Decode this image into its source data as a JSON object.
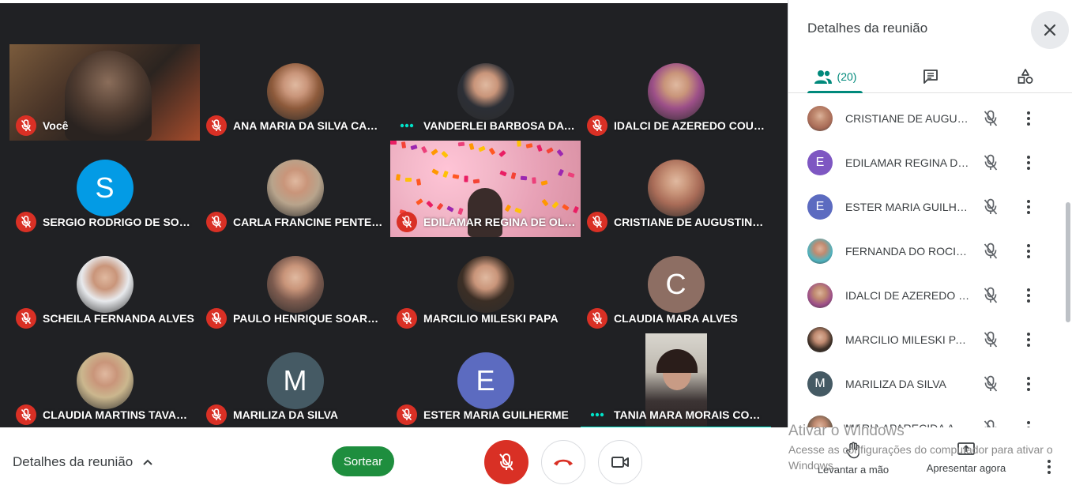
{
  "grid": {
    "tiles": [
      {
        "name": "Você",
        "mic": "off",
        "kind": "video-self"
      },
      {
        "name": "ANA MARIA DA SILVA CAMP...",
        "mic": "off",
        "kind": "photo",
        "color": "#8d5a3b"
      },
      {
        "name": "VANDERLEI BARBOSA DA SI...",
        "mic": "speaking",
        "kind": "photo",
        "color": "#2c2f36"
      },
      {
        "name": "IDALCI DE AZEREDO COUTIN...",
        "mic": "off",
        "kind": "photo",
        "color": "#9c4f88"
      },
      {
        "name": "SERGIO RODRIGO DE SOUZA...",
        "mic": "off",
        "kind": "letter",
        "letter": "S",
        "color": "#039be5"
      },
      {
        "name": "CARLA FRANCINE PENTEADO",
        "mic": "off",
        "kind": "photo",
        "color": "#b8a48c"
      },
      {
        "name": "EDILAMAR REGINA DE OLIV...",
        "mic": "off",
        "kind": "video-confetti"
      },
      {
        "name": "CRISTIANE DE AUGUSTINHO...",
        "mic": "off",
        "kind": "photo",
        "color": "#a86b57"
      },
      {
        "name": "SCHEILA FERNANDA ALVES",
        "mic": "off",
        "kind": "photo",
        "color": "#e8eaed"
      },
      {
        "name": "PAULO HENRIQUE SOARES B...",
        "mic": "off",
        "kind": "photo",
        "color": "#7b5a4e"
      },
      {
        "name": "MARCILIO MILESKI PAPA",
        "mic": "off",
        "kind": "photo",
        "color": "#3b2e25"
      },
      {
        "name": "CLAUDIA MARA ALVES",
        "mic": "off",
        "kind": "letter",
        "letter": "C",
        "color": "#8d6e63"
      },
      {
        "name": "CLAUDIA MARTINS TAVARES",
        "mic": "off",
        "kind": "photo",
        "color": "#cbb78e"
      },
      {
        "name": "MARILIZA DA SILVA",
        "mic": "off",
        "kind": "letter",
        "letter": "M",
        "color": "#455a64"
      },
      {
        "name": "ESTER MARIA GUILHERME",
        "mic": "off",
        "kind": "letter",
        "letter": "E",
        "color": "#5c6bc0"
      },
      {
        "name": "TANIA MARA MORAIS CORD...",
        "mic": "speaking",
        "kind": "video-tania"
      }
    ]
  },
  "side": {
    "title": "Detalhes da reunião",
    "tabs": {
      "people_count": "(20)"
    },
    "participants": [
      {
        "name": "CRISTIANE DE AUGUSTI...",
        "avatar": "photo",
        "color": "#a86b57"
      },
      {
        "name": "EDILAMAR REGINA DE ...",
        "avatar": "letter",
        "letter": "E",
        "color": "#7e57c2"
      },
      {
        "name": "ESTER MARIA GUILHER...",
        "avatar": "letter",
        "letter": "E",
        "color": "#5c6bc0"
      },
      {
        "name": "FERNANDA DO ROCIO ...",
        "avatar": "photo",
        "color": "#4fb3bf"
      },
      {
        "name": "IDALCI DE AZEREDO C...",
        "avatar": "photo",
        "color": "#9c4f88"
      },
      {
        "name": "MARCILIO MILESKI PAPA",
        "avatar": "photo",
        "color": "#3b2e25"
      },
      {
        "name": "MARILIZA DA SILVA",
        "avatar": "letter",
        "letter": "M",
        "color": "#455a64"
      },
      {
        "name": "MARIA APARECIDA ALB...",
        "avatar": "photo",
        "color": "#6d5a4a"
      }
    ]
  },
  "bottom": {
    "details_label": "Detalhes da reunião",
    "sortear_label": "Sortear",
    "raise_label": "Levantar a mão",
    "present_label": "Apresentar agora"
  },
  "watermark": {
    "title": "Ativar o Windows",
    "subtitle": "Acesse as configurações do computador para ativar o Windows."
  },
  "colors": {
    "accent": "#00897b",
    "danger": "#d93025",
    "button_green": "#1e8e3e"
  }
}
